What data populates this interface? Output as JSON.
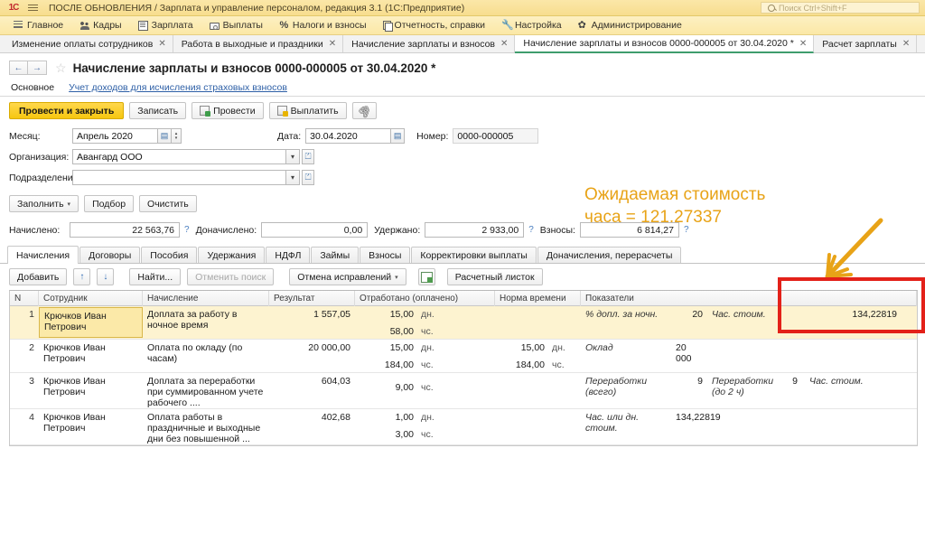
{
  "window": {
    "title": "ПОСЛЕ ОБНОВЛЕНИЯ / Зарплата и управление персоналом, редакция 3.1  (1С:Предприятие)",
    "logo": "1C",
    "search_placeholder": "Поиск Ctrl+Shift+F"
  },
  "menubar": [
    {
      "label": "Главное",
      "icon": "burger-icon"
    },
    {
      "label": "Кадры",
      "icon": "people-icon"
    },
    {
      "label": "Зарплата",
      "icon": "document-icon"
    },
    {
      "label": "Выплаты",
      "icon": "money-icon"
    },
    {
      "label": "Налоги и взносы",
      "icon": "percent-icon"
    },
    {
      "label": "Отчетность, справки",
      "icon": "report-icon"
    },
    {
      "label": "Настройка",
      "icon": "wrench-icon"
    },
    {
      "label": "Администрирование",
      "icon": "gear-icon"
    }
  ],
  "tabs": [
    {
      "label": "Изменение оплаты сотрудников",
      "active": false
    },
    {
      "label": "Работа в выходные и праздники",
      "active": false
    },
    {
      "label": "Начисление зарплаты и взносов",
      "active": false
    },
    {
      "label": "Начисление зарплаты и взносов 0000-000005 от 30.04.2020 *",
      "active": true
    },
    {
      "label": "Расчет зарплаты",
      "active": false
    }
  ],
  "document": {
    "title": "Начисление зарплаты и взносов 0000-000005 от 30.04.2020 *",
    "back_arrow": "←",
    "forward_arrow": "→",
    "star": "☆"
  },
  "subnav": {
    "current": "Основное",
    "link": "Учет доходов для исчисления страховых взносов"
  },
  "commandbar": {
    "post_and_close": "Провести и закрыть",
    "write": "Записать",
    "post": "Провести",
    "pay": "Выплатить",
    "attach_icon": "paperclip-icon"
  },
  "form": {
    "month_label": "Месяц:",
    "month_value": "Апрель 2020",
    "date_label": "Дата:",
    "date_value": "30.04.2020",
    "number_label": "Номер:",
    "number_value": "0000-000005",
    "org_label": "Организация:",
    "org_value": "Авангард ООО",
    "dept_label": "Подразделение:",
    "dept_value": ""
  },
  "fillbar": {
    "fill": "Заполнить",
    "select": "Подбор",
    "clear": "Очистить"
  },
  "totals": [
    {
      "label": "Начислено:",
      "value": "22 563,76",
      "help": "?"
    },
    {
      "label": "Доначислено:",
      "value": "0,00",
      "help": ""
    },
    {
      "label": "Удержано:",
      "value": "2 933,00",
      "help": "?"
    },
    {
      "label": "Взносы:",
      "value": "6 814,27",
      "help": "?"
    }
  ],
  "section_tabs": [
    {
      "label": "Начисления",
      "active": true
    },
    {
      "label": "Договоры",
      "active": false
    },
    {
      "label": "Пособия",
      "active": false
    },
    {
      "label": "Удержания",
      "active": false
    },
    {
      "label": "НДФЛ",
      "active": false
    },
    {
      "label": "Займы",
      "active": false
    },
    {
      "label": "Взносы",
      "active": false
    },
    {
      "label": "Корректировки выплаты",
      "active": false
    },
    {
      "label": "Доначисления, перерасчеты",
      "active": false
    }
  ],
  "table_toolbar": {
    "add": "Добавить",
    "move_up": "↑",
    "move_down": "↓",
    "find": "Найти...",
    "cancel_search": "Отменить поиск",
    "cancel_fixes": "Отмена исправлений",
    "grid_icon": "grid-settings-icon",
    "payslip": "Расчетный листок"
  },
  "table": {
    "headers": [
      "N",
      "Сотрудник",
      "Начисление",
      "Результат",
      "Отработано (оплачено)",
      "Норма времени",
      "Показатели"
    ],
    "rows": [
      {
        "n": "1",
        "employee": "Крючков Иван Петрович",
        "accrual": "Доплата за работу в ночное время",
        "result": "1 557,05",
        "worked_1": "15,00",
        "worked_unit_1": "дн.",
        "worked_2": "58,00",
        "worked_unit_2": "чс.",
        "norm_1": "",
        "norm_unit_1": "",
        "norm_2": "",
        "norm_unit_2": "",
        "ind_name_1": "% допл. за ночн.",
        "ind_val_1": "20",
        "ind_name_2": "Час. стоим.",
        "ind_val_2": "134,22819",
        "selected": true
      },
      {
        "n": "2",
        "employee": "Крючков Иван Петрович",
        "accrual": "Оплата по окладу (по часам)",
        "result": "20 000,00",
        "worked_1": "15,00",
        "worked_unit_1": "дн.",
        "worked_2": "184,00",
        "worked_unit_2": "чс.",
        "norm_1": "15,00",
        "norm_unit_1": "дн.",
        "norm_2": "184,00",
        "norm_unit_2": "чс.",
        "ind_name_1": "Оклад",
        "ind_val_1": "20 000",
        "ind_name_2": "",
        "ind_val_2": "",
        "selected": false
      },
      {
        "n": "3",
        "employee": "Крючков Иван Петрович",
        "accrual": "Доплата за переработки при суммированном учете рабочего ....",
        "result": "604,03",
        "worked_1": "",
        "worked_unit_1": "",
        "worked_2": "9,00",
        "worked_unit_2": "чс.",
        "norm_1": "",
        "norm_unit_1": "",
        "norm_2": "",
        "norm_unit_2": "",
        "ind_name_1": "Переработки (всего)",
        "ind_val_1": "9",
        "ind_name_2": "Переработки (до 2 ч)",
        "ind_val_2": "9",
        "ind_name_3": "Час. стоим.",
        "ind_val_3": "",
        "selected": false
      },
      {
        "n": "4",
        "employee": "Крючков Иван Петрович",
        "accrual": "Оплата работы в праздничные и выходные дни без повышенной ...",
        "result": "402,68",
        "worked_1": "1,00",
        "worked_unit_1": "дн.",
        "worked_2": "3,00",
        "worked_unit_2": "чс.",
        "norm_1": "",
        "norm_unit_1": "",
        "norm_2": "",
        "norm_unit_2": "",
        "ind_name_1": "Час. или дн. стоим.",
        "ind_val_1": "134,22819",
        "ind_name_2": "",
        "ind_val_2": "",
        "selected": false
      }
    ]
  },
  "annotation": {
    "text": "Ожидаемая стоимость\nчаса = 121.27337",
    "color": "#e8a317",
    "highlight_color": "#e32119"
  }
}
